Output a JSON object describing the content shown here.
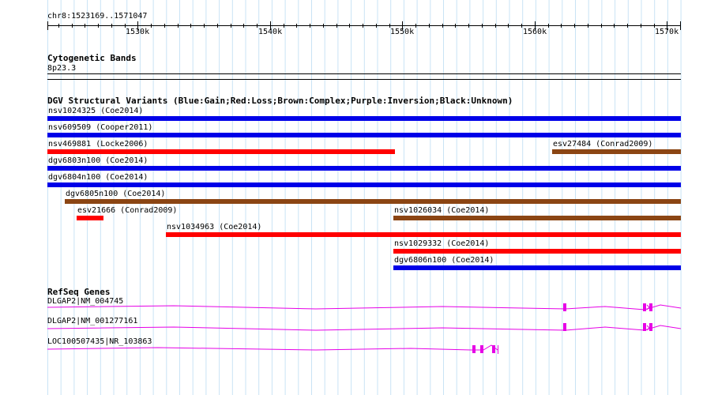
{
  "ruler": {
    "position": "chr8:1523169..1571047",
    "start": 1523169,
    "end": 1571047,
    "ticks": [
      {
        "pos": 1530000,
        "label": "1530k"
      },
      {
        "pos": 1540000,
        "label": "1540k"
      },
      {
        "pos": 1550000,
        "label": "1550k"
      },
      {
        "pos": 1560000,
        "label": "1560k"
      },
      {
        "pos": 1570000,
        "label": "1570k"
      }
    ]
  },
  "cytoband": {
    "title": "Cytogenetic Bands",
    "band": "8p23.3"
  },
  "dgv": {
    "title": "DGV Structural Variants (Blue:Gain;Red:Loss;Brown:Complex;Purple:Inversion;Black:Unknown)",
    "colors": {
      "gain": "#0000e8",
      "loss": "#ff0000",
      "complex": "#8b4513"
    },
    "features": [
      {
        "label": "nsv1024325 (Coe2014)",
        "type": "gain",
        "start": 1523169,
        "end": 1571047,
        "row": 0
      },
      {
        "label": "nsv609509 (Cooper2011)",
        "type": "gain",
        "start": 1523169,
        "end": 1571047,
        "row": 1
      },
      {
        "label": "nsv469881 (Locke2006)",
        "type": "loss",
        "start": 1523169,
        "end": 1549450,
        "row": 2
      },
      {
        "label": "esv27484 (Conrad2009)",
        "type": "complex",
        "start": 1561300,
        "end": 1571047,
        "row": 2
      },
      {
        "label": "dgv6803n100 (Coe2014)",
        "type": "gain",
        "start": 1523169,
        "end": 1571047,
        "row": 3
      },
      {
        "label": "dgv6804n100 (Coe2014)",
        "type": "gain",
        "start": 1523169,
        "end": 1571047,
        "row": 4
      },
      {
        "label": "dgv6805n100 (Coe2014)",
        "type": "complex",
        "start": 1524500,
        "end": 1571047,
        "row": 5
      },
      {
        "label": "esv21666 (Conrad2009)",
        "type": "loss",
        "start": 1525400,
        "end": 1527400,
        "row": 6
      },
      {
        "label": "nsv1026034 (Coe2014)",
        "type": "complex",
        "start": 1549300,
        "end": 1571047,
        "row": 6
      },
      {
        "label": "nsv1034963 (Coe2014)",
        "type": "loss",
        "start": 1532100,
        "end": 1571047,
        "row": 7
      },
      {
        "label": "nsv1029332 (Coe2014)",
        "type": "loss",
        "start": 1549300,
        "end": 1571047,
        "row": 8
      },
      {
        "label": "dgv6806n100 (Coe2014)",
        "type": "gain",
        "start": 1549300,
        "end": 1571047,
        "row": 9
      }
    ]
  },
  "refseq": {
    "title": "RefSeq Genes",
    "color": "#e600e6",
    "genes": [
      {
        "label": "DLGAP2|NM_004745",
        "start": 1523169,
        "end": 1571047,
        "exons": [
          1562300,
          1568300,
          1568800
        ]
      },
      {
        "label": "DLGAP2|NM_001277161",
        "start": 1523169,
        "end": 1571047,
        "exons": [
          1562300,
          1568300,
          1568800
        ]
      },
      {
        "label": "LOC100507435|NR_103863",
        "start": 1523169,
        "end": 1556900,
        "exons": [
          1555400,
          1556000,
          1556900
        ]
      }
    ]
  }
}
